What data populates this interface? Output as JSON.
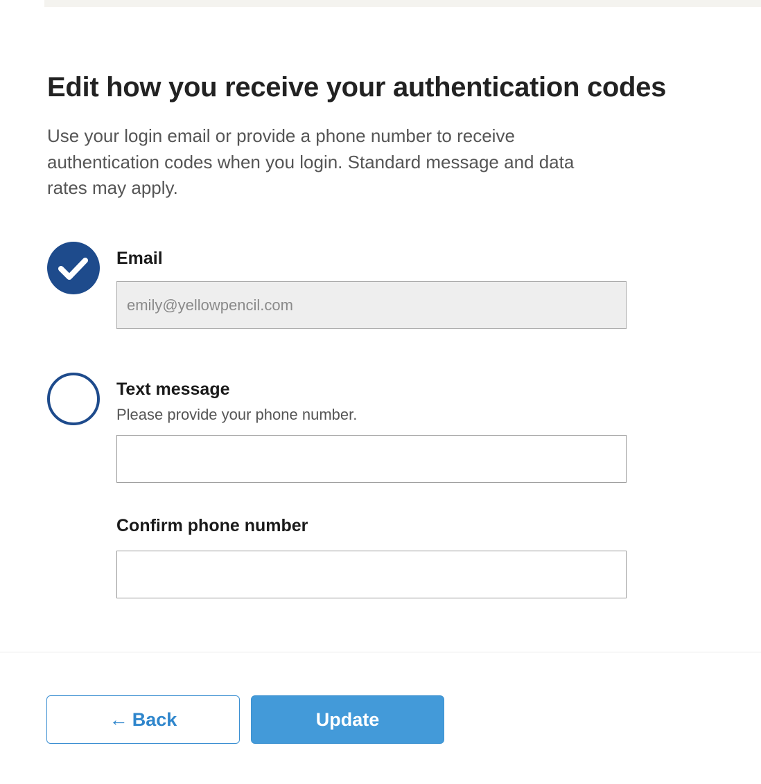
{
  "header": {
    "title": "Edit how you receive your authentication codes",
    "description": "Use your login email or provide a phone number to receive authentication codes when you login. Standard message and data rates may apply."
  },
  "options": {
    "email": {
      "label": "Email",
      "selected": true,
      "value": "emily@yellowpencil.com",
      "disabled": true
    },
    "text_message": {
      "label": "Text message",
      "selected": false,
      "hint": "Please provide your phone number.",
      "phone_value": "",
      "confirm_label": "Confirm phone number",
      "confirm_value": ""
    }
  },
  "footer": {
    "back_arrow": "←",
    "back_label": "Back",
    "update_label": "Update"
  },
  "colors": {
    "primary_navy": "#1e4b8c",
    "button_blue": "#439ad9",
    "link_blue": "#2f86cc"
  },
  "icons": {
    "email_option": "checkmark-circle-icon",
    "text_option": "empty-circle-icon",
    "back_button": "left-arrow-icon"
  }
}
